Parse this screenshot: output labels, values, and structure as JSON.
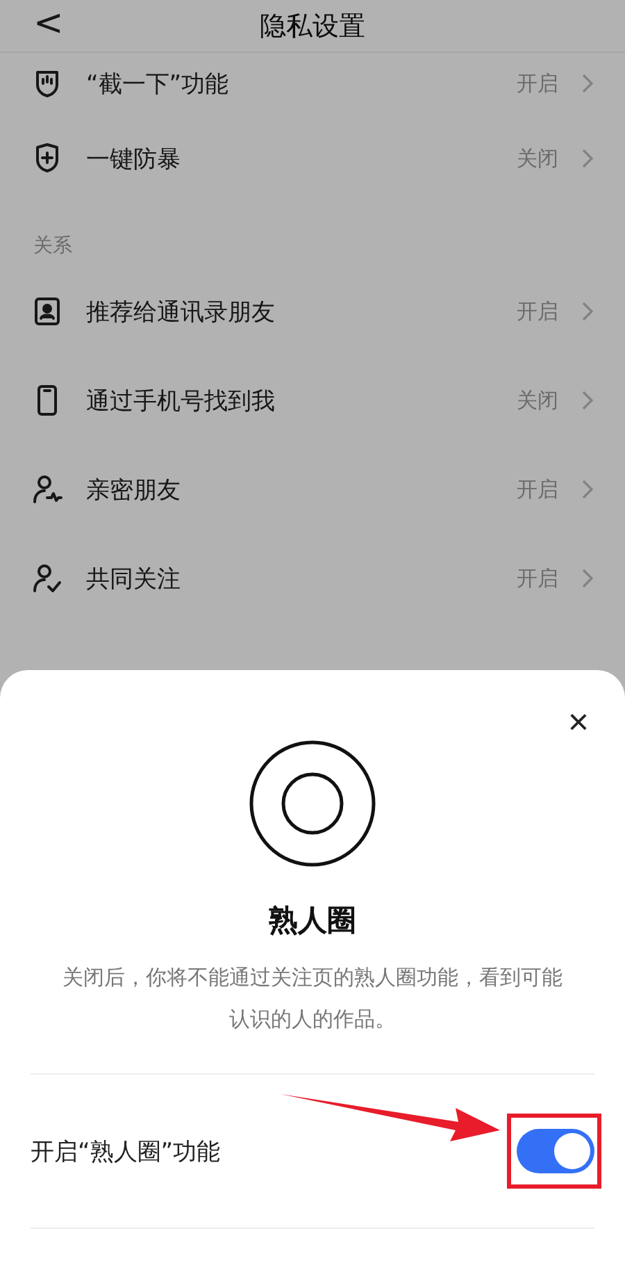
{
  "header": {
    "back": "<",
    "title": "隐私设置"
  },
  "groups": [
    {
      "rows": [
        {
          "label": "“截一下”功能",
          "value": "开启"
        },
        {
          "label": "一键防暴",
          "value": "关闭"
        }
      ]
    },
    {
      "heading": "关系",
      "rows": [
        {
          "label": "推荐给通讯录朋友",
          "value": "开启"
        },
        {
          "label": "通过手机号找到我",
          "value": "关闭"
        },
        {
          "label": "亲密朋友",
          "value": "开启"
        },
        {
          "label": "共同关注",
          "value": "开启"
        }
      ]
    }
  ],
  "sheet": {
    "close": "×",
    "title": "熟人圈",
    "description": "关闭后，你将不能通过关注页的熟人圈功能，看到可能认识的人的作品。",
    "toggle": {
      "label": "开启“熟人圈”功能",
      "on": true
    }
  }
}
